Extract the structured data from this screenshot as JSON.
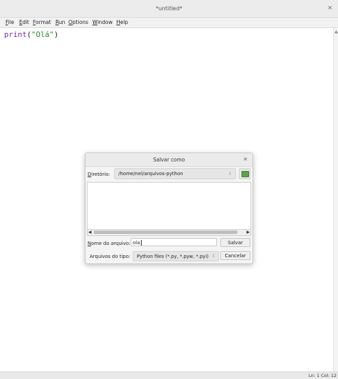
{
  "window": {
    "title": "*untitled*",
    "close_glyph": "×"
  },
  "menubar": {
    "items": [
      "File",
      "Edit",
      "Format",
      "Run",
      "Options",
      "Window",
      "Help"
    ]
  },
  "editor": {
    "code": {
      "fn": "print",
      "open": "(",
      "string": "\"Olá\"",
      "close": ")"
    }
  },
  "statusbar": {
    "position": "Ln: 1   Col: 12"
  },
  "dialog": {
    "title": "Salvar como",
    "close_glyph": "×",
    "directory_label": "Diretório:",
    "directory_value": "/home/nel/arquivos-python",
    "new_folder_icon": "new-folder-icon",
    "filename_label": "Nome do arquivo:",
    "filename_value": "ola",
    "save_button": "Salvar",
    "filetype_label": "Arquivos do tipo:",
    "filetype_value": "Python files (*.py, *.pyw, *.pyi)",
    "cancel_button": "Cancelar"
  },
  "colors": {
    "keyword": "#7a2fb0",
    "string": "#1f8a1f",
    "folder_icon": "#5aa545"
  }
}
